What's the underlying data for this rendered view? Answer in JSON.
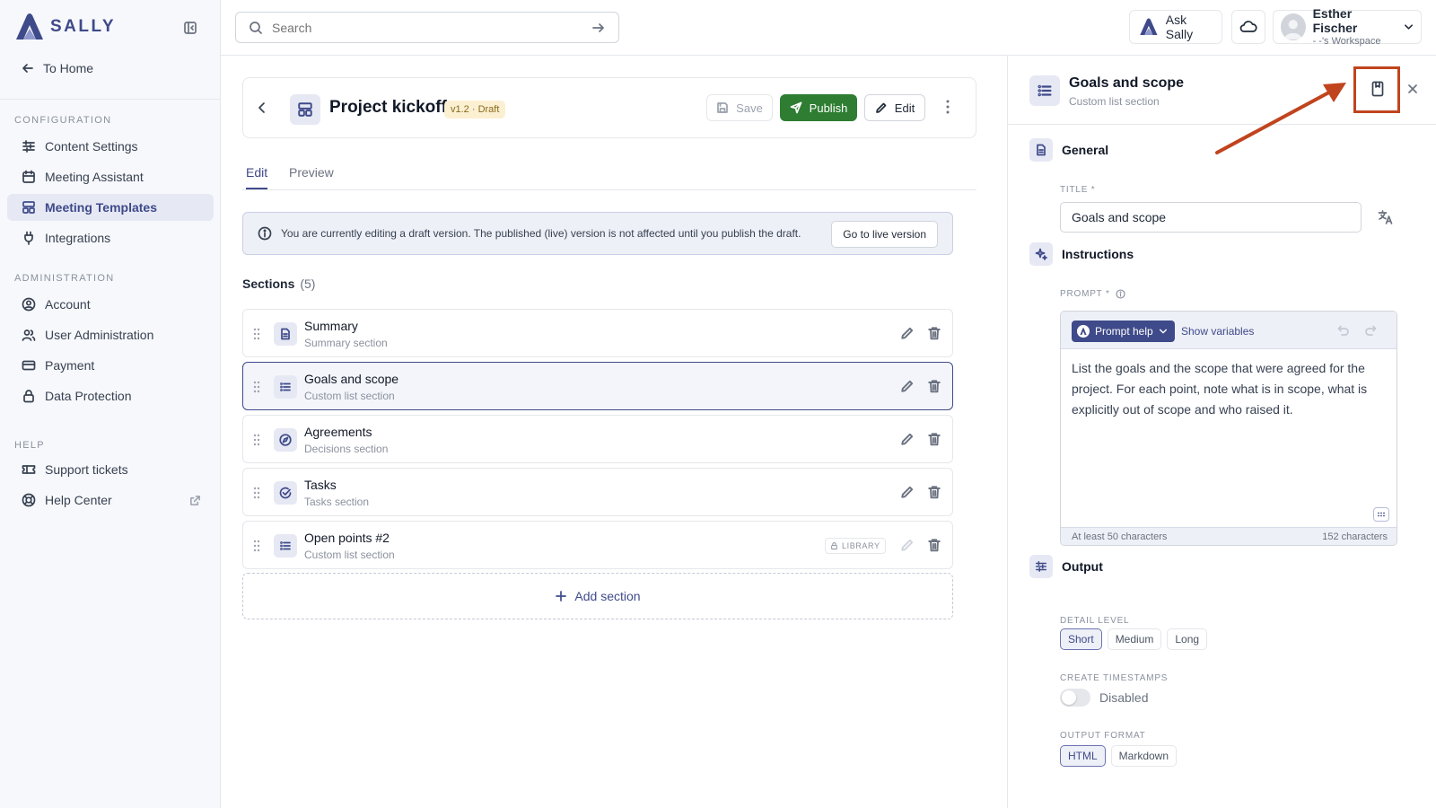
{
  "app": {
    "logo_text": "SALLY",
    "accent": "#3f4a8a"
  },
  "sidebar": {
    "to_home": "To Home",
    "groups": [
      {
        "title": "CONFIGURATION",
        "items": [
          {
            "label": "Content Settings",
            "icon": "sliders-icon"
          },
          {
            "label": "Meeting Assistant",
            "icon": "calendar-icon"
          },
          {
            "label": "Meeting Templates",
            "icon": "template-icon",
            "active": true
          },
          {
            "label": "Integrations",
            "icon": "plug-icon"
          }
        ]
      },
      {
        "title": "ADMINISTRATION",
        "items": [
          {
            "label": "Account",
            "icon": "account-icon"
          },
          {
            "label": "User Administration",
            "icon": "users-icon"
          },
          {
            "label": "Payment",
            "icon": "card-icon"
          },
          {
            "label": "Data Protection",
            "icon": "lock-icon"
          }
        ]
      },
      {
        "title": "HELP",
        "items": [
          {
            "label": "Support tickets",
            "icon": "ticket-icon"
          },
          {
            "label": "Help Center",
            "icon": "lifebuoy-icon"
          }
        ]
      }
    ]
  },
  "topbar": {
    "search_placeholder": "Search",
    "ask_label": "Ask Sally",
    "user_name": "Esther Fischer",
    "user_workspace": "- -'s Workspace"
  },
  "editor": {
    "title": "Project kickoff",
    "badge": "v1.2 · Draft",
    "save_label": "Save",
    "publish_label": "Publish",
    "edit_label": "Edit",
    "tabs": [
      "Edit",
      "Preview"
    ],
    "notice": "You are currently editing a draft version. The published (live) version is not affected until you publish the draft.",
    "notice_button": "Go to live version",
    "sections_label": "Sections",
    "sections_count": "(5)",
    "sections": [
      {
        "title": "Summary",
        "subtitle": "Summary section"
      },
      {
        "title": "Goals and scope",
        "subtitle": "Custom list section",
        "selected": true
      },
      {
        "title": "Agreements",
        "subtitle": "Decisions section"
      },
      {
        "title": "Tasks",
        "subtitle": "Tasks section"
      },
      {
        "title": "Open points #2",
        "subtitle": "Custom list section",
        "badge": "LIBRARY"
      }
    ],
    "add_section": "Add section"
  },
  "panel": {
    "title": "Goals and scope",
    "subtitle": "Custom list section",
    "general": {
      "heading": "General",
      "title_label": "TITLE *",
      "title_value": "Goals and scope"
    },
    "instructions": {
      "heading": "Instructions",
      "prompt_label": "PROMPT *",
      "prompt_help": "Prompt help",
      "show_variables": "Show variables",
      "prompt_text": "List the goals and the scope that were agreed for the project. For each point, note what is in scope, what is explicitly out of scope and who raised it.",
      "min_chars": "At least 50 characters",
      "char_count": "152 characters"
    },
    "output": {
      "heading": "Output",
      "detail_label": "DETAIL LEVEL",
      "detail_options": [
        "Short",
        "Medium",
        "Long"
      ],
      "detail_selected": "Short",
      "timestamps_label": "CREATE TIMESTAMPS",
      "timestamps_state": "Disabled",
      "format_label": "OUTPUT FORMAT",
      "format_options": [
        "HTML",
        "Markdown"
      ],
      "format_selected": "HTML"
    }
  },
  "annotation": {
    "color": "#c0441e"
  }
}
